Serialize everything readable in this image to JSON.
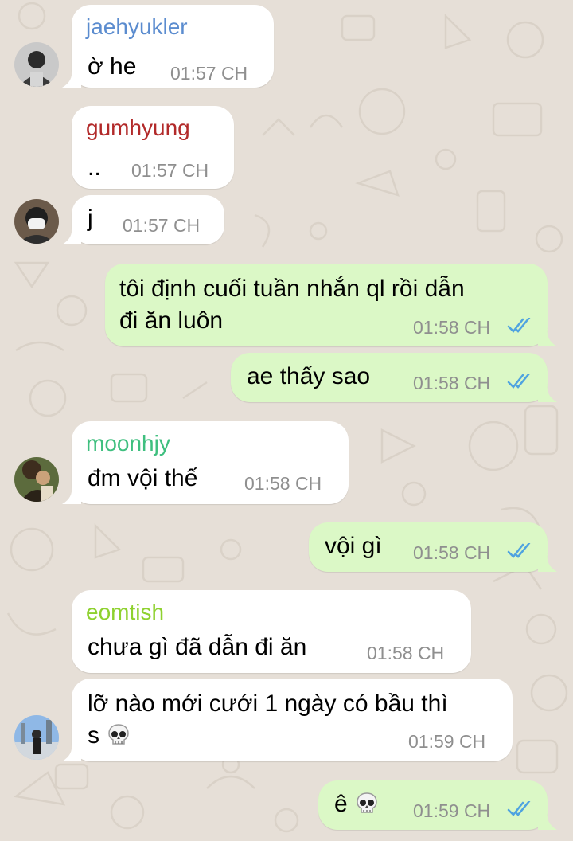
{
  "colors": {
    "background": "#e6dfd7",
    "incoming_bubble": "#ffffff",
    "outgoing_bubble": "#dbf8c6",
    "timestamp": "#8f8f8f",
    "read_ticks": "#4fa3e0"
  },
  "messages": [
    {
      "sender": "jaehyukler",
      "sender_color": "#5b8ccf",
      "text": "ờ he",
      "time": "01:57 CH",
      "direction": "incoming"
    },
    {
      "sender": "gumhyung",
      "sender_color": "#b22a2a",
      "text": "..",
      "time": "01:57 CH",
      "direction": "incoming"
    },
    {
      "text": "j",
      "time": "01:57 CH",
      "direction": "incoming"
    },
    {
      "text_line1": "tôi định cuối tuần nhắn ql rồi dẫn",
      "text_line2": "đi ăn luôn",
      "time": "01:58 CH",
      "direction": "outgoing",
      "status": "read"
    },
    {
      "text": "ae thấy sao",
      "time": "01:58 CH",
      "direction": "outgoing",
      "status": "read"
    },
    {
      "sender": "moonhjy",
      "sender_color": "#3fbf7f",
      "text": "đm vội thế",
      "time": "01:58 CH",
      "direction": "incoming"
    },
    {
      "text": "vội gì",
      "time": "01:58 CH",
      "direction": "outgoing",
      "status": "read"
    },
    {
      "sender": "eomtish",
      "sender_color": "#8ed12f",
      "text": "chưa gì đã dẫn đi ăn",
      "time": "01:58 CH",
      "direction": "incoming"
    },
    {
      "text_line1": "lỡ nào mới cưới 1 ngày có bầu thì",
      "text_line2": "s",
      "emoji": "skull",
      "time": "01:59 CH",
      "direction": "incoming"
    },
    {
      "text": "ê",
      "emoji": "skull",
      "time": "01:59 CH",
      "direction": "outgoing",
      "status": "read"
    }
  ]
}
